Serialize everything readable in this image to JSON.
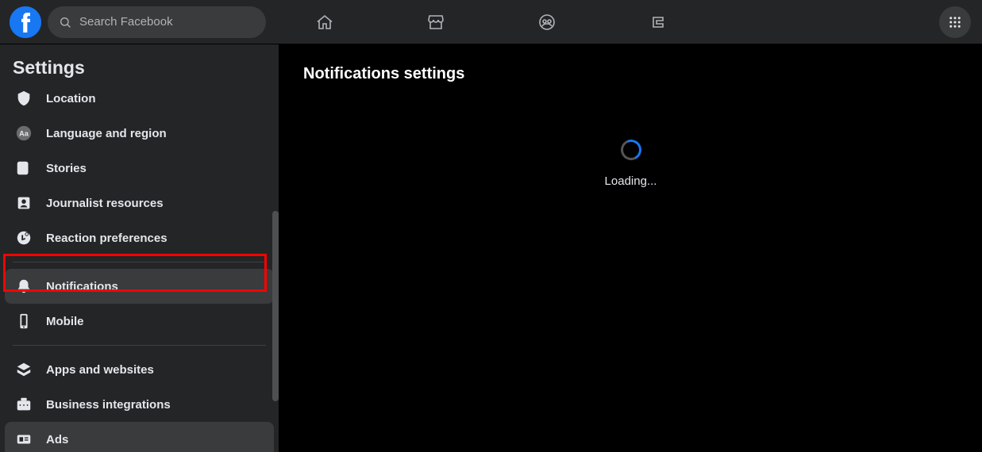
{
  "header": {
    "search_placeholder": "Search Facebook"
  },
  "sidebar": {
    "title": "Settings",
    "items": [
      {
        "label": "Location"
      },
      {
        "label": "Language and region"
      },
      {
        "label": "Stories"
      },
      {
        "label": "Journalist resources"
      },
      {
        "label": "Reaction preferences"
      },
      {
        "label": "Notifications"
      },
      {
        "label": "Mobile"
      },
      {
        "label": "Apps and websites"
      },
      {
        "label": "Business integrations"
      },
      {
        "label": "Ads"
      }
    ]
  },
  "main": {
    "title": "Notifications settings",
    "loading_label": "Loading..."
  }
}
